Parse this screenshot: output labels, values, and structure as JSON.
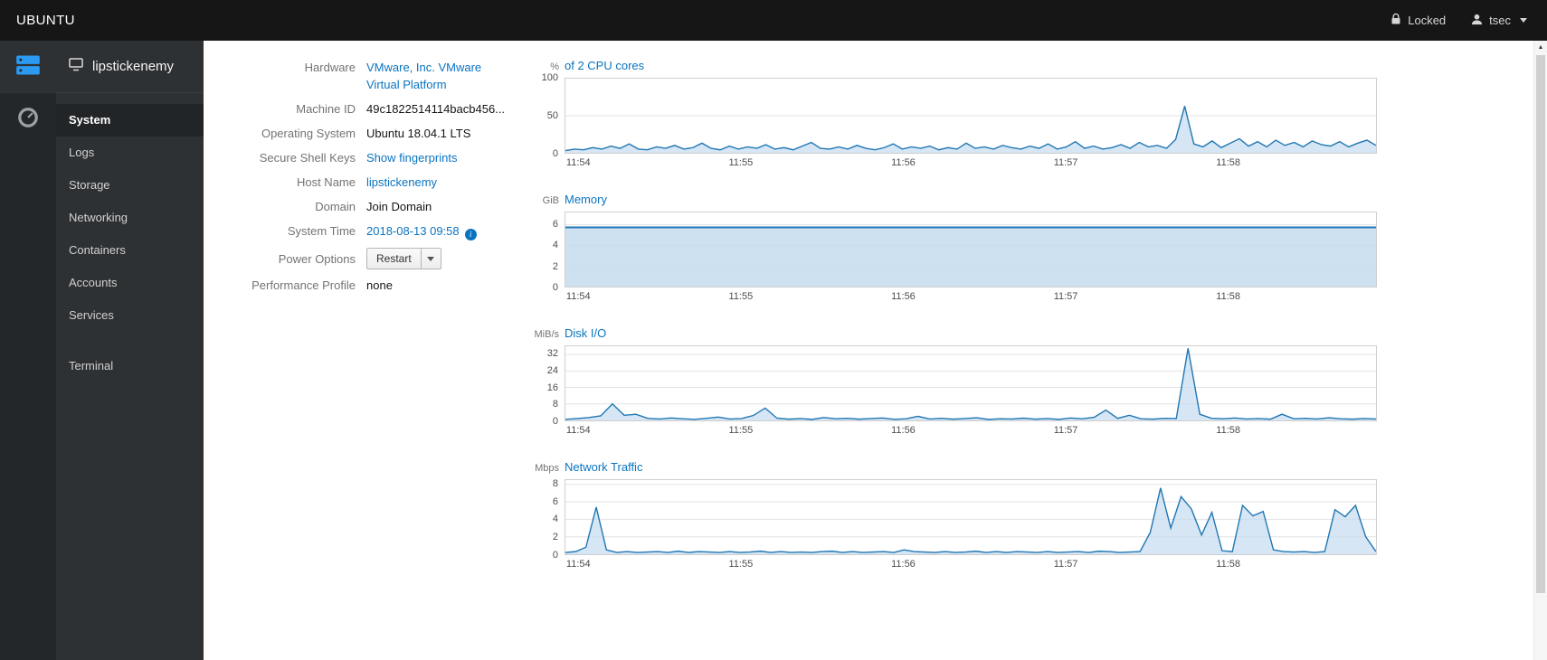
{
  "topbar": {
    "brand": "UBUNTU",
    "locked_label": "Locked",
    "user": "tsec"
  },
  "sidebar": {
    "host": "lipstickenemy",
    "items": [
      "System",
      "Logs",
      "Storage",
      "Networking",
      "Containers",
      "Accounts",
      "Services",
      "Terminal"
    ]
  },
  "system": {
    "hardware_label": "Hardware",
    "hardware_value": "VMware, Inc. VMware Virtual Platform",
    "machine_id_label": "Machine ID",
    "machine_id_value": "49c1822514114bacb456...",
    "os_label": "Operating System",
    "os_value": "Ubuntu 18.04.1 LTS",
    "ssh_label": "Secure Shell Keys",
    "ssh_value": "Show fingerprints",
    "hostname_label": "Host Name",
    "hostname_value": "lipstickenemy",
    "domain_label": "Domain",
    "domain_value": "Join Domain",
    "time_label": "System Time",
    "time_value": "2018-08-13 09:58",
    "power_label": "Power Options",
    "power_value": "Restart",
    "profile_label": "Performance Profile",
    "profile_value": "none"
  },
  "icons": {
    "info_glyph": "i",
    "scroll_up_glyph": "▲"
  },
  "colors": {
    "link": "#0a74c1",
    "chart_line": "#2077b4",
    "chart_fill": "#c5dcef",
    "accent_icon": "#2b9af3"
  },
  "charts": [
    {
      "type": "area",
      "unit": "%",
      "title": "of 2 CPU cores",
      "ymax": 100,
      "yticks": [
        100,
        50,
        0
      ],
      "xticks": [
        "11:54",
        "11:55",
        "11:56",
        "11:57",
        "11:58"
      ],
      "line_width": 1.4,
      "fill_opacity": 0.7,
      "values": [
        3,
        5,
        4,
        7,
        5,
        9,
        6,
        12,
        5,
        4,
        8,
        6,
        10,
        5,
        7,
        13,
        6,
        4,
        9,
        5,
        8,
        6,
        11,
        5,
        7,
        4,
        9,
        14,
        6,
        5,
        8,
        5,
        10,
        6,
        4,
        7,
        12,
        5,
        8,
        6,
        9,
        4,
        7,
        5,
        13,
        6,
        8,
        5,
        10,
        7,
        5,
        9,
        6,
        12,
        5,
        8,
        15,
        6,
        9,
        5,
        7,
        11,
        6,
        14,
        8,
        10,
        6,
        18,
        63,
        12,
        8,
        16,
        7,
        13,
        19,
        9,
        15,
        8,
        17,
        10,
        14,
        8,
        16,
        11,
        9,
        15,
        8,
        13,
        17,
        10
      ]
    },
    {
      "type": "area",
      "unit": "GiB",
      "title": "Memory",
      "ymax": 7.2,
      "yticks": [
        6,
        4,
        2,
        0
      ],
      "xticks": [
        "11:54",
        "11:55",
        "11:56",
        "11:57",
        "11:58"
      ],
      "line_width": 2,
      "fill_opacity": 0.85,
      "values": [
        5.75,
        5.75,
        5.75,
        5.75,
        5.75,
        5.75,
        5.75,
        5.75,
        5.75,
        5.75,
        5.75,
        5.75,
        5.75,
        5.75,
        5.75,
        5.75,
        5.75,
        5.75,
        5.75,
        5.75,
        5.75,
        5.75,
        5.75,
        5.75,
        5.75,
        5.75,
        5.75,
        5.75,
        5.75,
        5.75
      ]
    },
    {
      "type": "area",
      "unit": "MiB/s",
      "title": "Disk I/O",
      "ymax": 36,
      "yticks": [
        32,
        24,
        16,
        8,
        0
      ],
      "xticks": [
        "11:54",
        "11:55",
        "11:56",
        "11:57",
        "11:58"
      ],
      "line_width": 1.4,
      "fill_opacity": 0.7,
      "values": [
        0.5,
        0.9,
        1.4,
        2.2,
        8,
        2.5,
        3,
        1,
        0.7,
        1.2,
        0.8,
        0.5,
        1,
        1.6,
        0.7,
        0.9,
        2.4,
        6,
        1.1,
        0.6,
        0.9,
        0.5,
        1.4,
        0.8,
        1,
        0.6,
        0.9,
        1.2,
        0.5,
        0.8,
        2,
        0.7,
        1,
        0.6,
        0.9,
        1.3,
        0.5,
        0.8,
        0.7,
        1.1,
        0.6,
        0.9,
        0.5,
        1.2,
        0.8,
        1.5,
        5,
        1,
        2.5,
        0.8,
        0.6,
        1,
        0.9,
        35,
        3,
        1,
        0.8,
        1.2,
        0.7,
        0.9,
        0.6,
        3,
        0.8,
        1,
        0.7,
        1.3,
        0.8,
        0.6,
        0.9,
        0.7
      ]
    },
    {
      "type": "area",
      "unit": "Mbps",
      "title": "Network Traffic",
      "ymax": 8.5,
      "yticks": [
        8,
        6,
        4,
        2,
        0
      ],
      "xticks": [
        "11:54",
        "11:55",
        "11:56",
        "11:57",
        "11:58"
      ],
      "line_width": 1.4,
      "fill_opacity": 0.7,
      "values": [
        0.2,
        0.3,
        0.8,
        5.4,
        0.5,
        0.2,
        0.3,
        0.2,
        0.25,
        0.3,
        0.2,
        0.35,
        0.2,
        0.3,
        0.25,
        0.2,
        0.3,
        0.2,
        0.25,
        0.35,
        0.2,
        0.3,
        0.2,
        0.25,
        0.2,
        0.3,
        0.35,
        0.2,
        0.3,
        0.2,
        0.25,
        0.3,
        0.2,
        0.5,
        0.3,
        0.25,
        0.2,
        0.3,
        0.2,
        0.25,
        0.35,
        0.2,
        0.3,
        0.2,
        0.3,
        0.25,
        0.2,
        0.3,
        0.2,
        0.25,
        0.3,
        0.2,
        0.35,
        0.3,
        0.2,
        0.25,
        0.3,
        2.5,
        7.6,
        3,
        6.6,
        5.2,
        2.2,
        4.8,
        0.4,
        0.3,
        5.6,
        4.4,
        4.9,
        0.5,
        0.3,
        0.25,
        0.3,
        0.2,
        0.3,
        5.1,
        4.3,
        5.6,
        2,
        0.3
      ]
    }
  ]
}
